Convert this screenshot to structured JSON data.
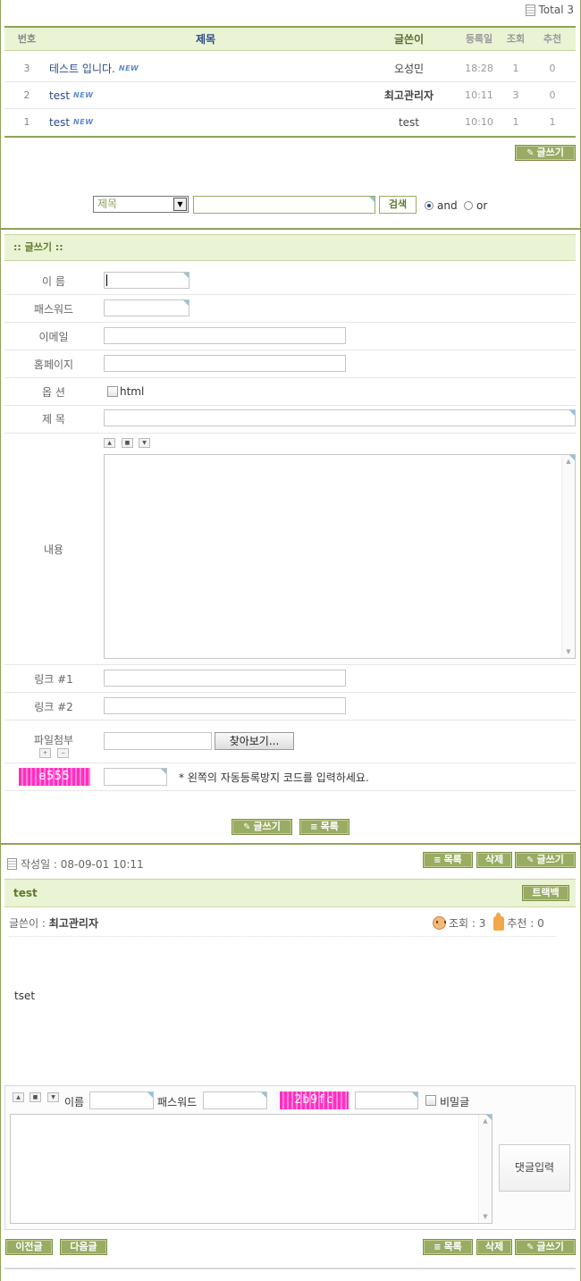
{
  "board": {
    "total_label": "Total 3",
    "columns": {
      "no": "번호",
      "title": "제목",
      "writer": "글쓴이",
      "date": "등록일",
      "hits": "조회",
      "votes": "추천"
    },
    "rows": [
      {
        "no": "3",
        "title": "테스트 입니다.",
        "badge": "NEW",
        "writer": "오성민",
        "date": "18:28",
        "hits": "1",
        "votes": "0"
      },
      {
        "no": "2",
        "title": "test",
        "badge": "NEW",
        "writer": "최고관리자",
        "date": "10:11",
        "hits": "3",
        "votes": "0"
      },
      {
        "no": "1",
        "title": "test",
        "badge": "NEW",
        "writer": "test",
        "date": "10:10",
        "hits": "1",
        "votes": "1"
      }
    ],
    "write_label": "글쓰기"
  },
  "search": {
    "field_selected": "제목",
    "input_value": "",
    "search_label": "검색",
    "and_label": "and",
    "or_label": "or"
  },
  "write_form": {
    "heading": ":: 글쓰기 ::",
    "name_label": "이 름",
    "password_label": "패스워드",
    "email_label": "이메일",
    "homepage_label": "홈페이지",
    "option_label": "옵 션",
    "html_label": "html",
    "subject_label": "제 목",
    "content_label": "내용",
    "link1_label": "링크 #1",
    "link2_label": "링크 #2",
    "file_label": "파일첨부",
    "browse_label": "찾아보기...",
    "captcha_code": "e555",
    "captcha_note": "* 왼쪽의 자동등록방지 코드를 입력하세요.",
    "submit_label": "글쓰기",
    "list_label": "목록"
  },
  "view": {
    "date_text": "작성일 : 08-09-01 10:11",
    "list_label": "목록",
    "delete_label": "삭제",
    "write_label": "글쓰기",
    "title": "test",
    "trackback_label": "트랙백",
    "writer_prefix": "글쓴이 : ",
    "writer_name": "최고관리자",
    "hits_text": "조회 : 3",
    "votes_text": "추천 : 0",
    "content": "tset"
  },
  "comment": {
    "name_label": "이름",
    "password_label": "패스워드",
    "captcha_code": "2b9fc",
    "secret_label": "비밀글",
    "submit_label": "댓글입력"
  },
  "nav": {
    "prev_label": "이전글",
    "next_label": "다음글",
    "list_label": "목록",
    "delete_label": "삭제",
    "write_label": "글쓰기"
  },
  "colors": {
    "accent": "#8fa35a",
    "header_bg": "#eaf3d4",
    "button": "#9aab63",
    "captcha": "#ff2fbf"
  }
}
